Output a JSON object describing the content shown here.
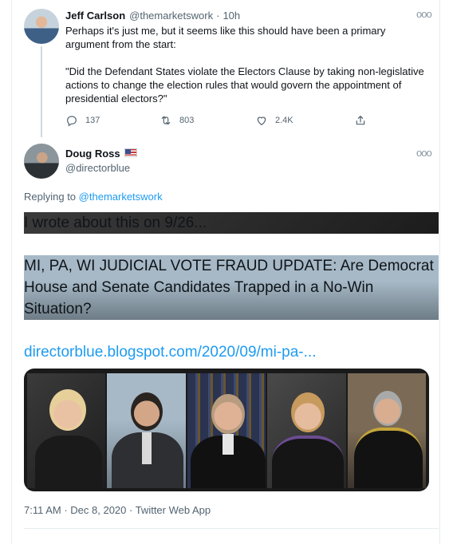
{
  "tweet1": {
    "display_name": "Jeff Carlson",
    "handle": "@themarketswork",
    "separator": "·",
    "time": "10h",
    "more": "ooo",
    "body": [
      "Perhaps it's just me, but it seems like this should have been a primary argument from the start:",
      "\"Did the Defendant States violate the Electors Clause by taking non-legislative actions to change the election rules that would govern the appointment of presidential electors?\""
    ],
    "actions": {
      "reply_count": "137",
      "retweet_count": "803",
      "like_count": "2.4K"
    }
  },
  "tweet2": {
    "display_name": "Doug Ross",
    "handle": "@directorblue",
    "more": "ooo",
    "replying_prefix": "Replying to",
    "replying_handle": "@themarketswork",
    "body_p1": "I wrote about this on 9/26...",
    "body_p2": "MI, PA, WI JUDICIAL VOTE FRAUD UPDATE: Are Democrat House and Senate Candidates Trapped in a No-Win Situation?",
    "link": "directorblue.blogspot.com/2020/09/mi-pa-...",
    "timestamp": "7:11 AM · Dec 8, 2020 · Twitter Web App"
  },
  "colors": {
    "link_blue": "#1d9bf0",
    "muted_gray": "#536471",
    "border": "#e6ecf0"
  },
  "icons": [
    "reply-icon",
    "retweet-icon",
    "like-icon",
    "share-icon",
    "more-icon",
    "us-flag-icon"
  ]
}
